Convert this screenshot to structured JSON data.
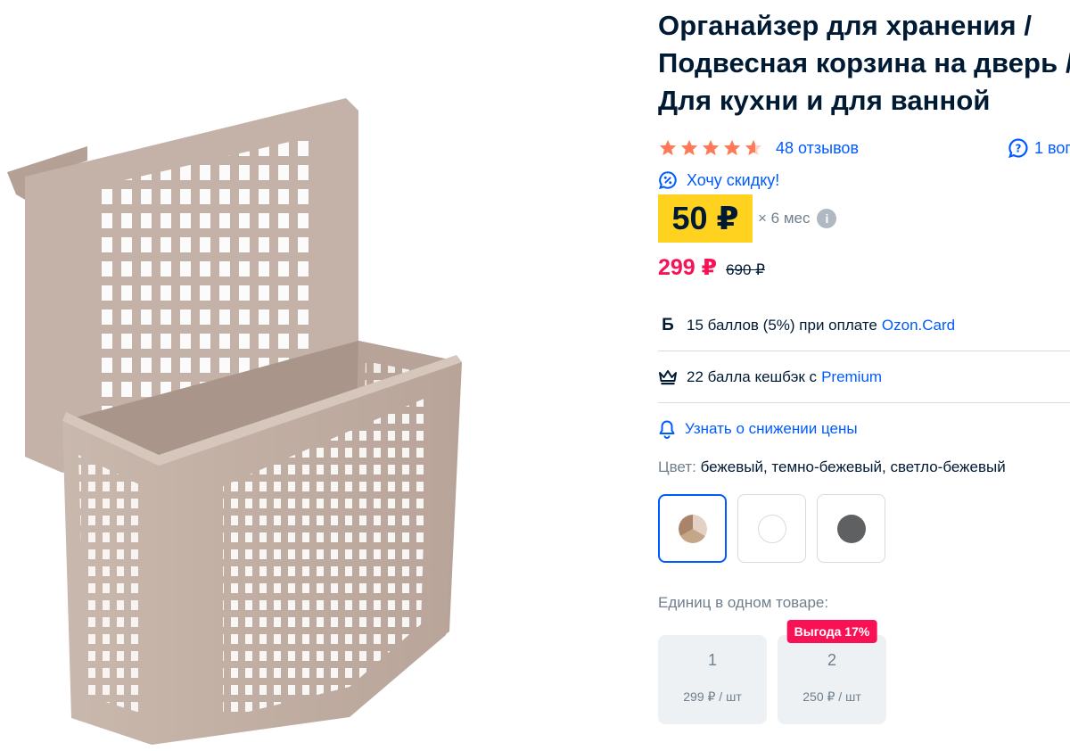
{
  "product": {
    "title_lines": [
      "Органайзер для хранения /",
      "Подвесная корзина на дверь /",
      "Для кухни и для ванной"
    ],
    "image_icon": "hanging-basket-photo"
  },
  "rating": {
    "stars": 4.5,
    "reviews_label": "48 отзывов",
    "questions_label": "1 воп"
  },
  "discount_link": "Хочу скидку!",
  "installment": {
    "amount": "50 ₽",
    "term": "× 6 мес",
    "info_glyph": "i"
  },
  "price": {
    "current": "299 ₽",
    "old": "690 ₽"
  },
  "bonuses": [
    {
      "icon_glyph": "Б",
      "icon": "points-icon",
      "text": "15 баллов (5%) при оплате",
      "link": "Ozon.Card"
    },
    {
      "icon": "crown-icon",
      "text": "22 балла кешбэк с",
      "link": "Premium"
    }
  ],
  "notify_link": "Узнать о снижении цены",
  "color": {
    "label": "Цвет:",
    "value": "бежевый, темно-бежевый, светло-бежевый",
    "swatches": [
      {
        "name": "multi-beige",
        "selected": true
      },
      {
        "name": "white",
        "color": "#ffffff",
        "selected": false
      },
      {
        "name": "dark-gray",
        "color": "#5f6062",
        "selected": false
      }
    ]
  },
  "units": {
    "label": "Единиц в одном товаре:",
    "options": [
      {
        "count": "1",
        "price": "299 ₽ / шт",
        "badge": ""
      },
      {
        "count": "2",
        "price": "250 ₽ / шт",
        "badge": "Выгода 17%"
      }
    ]
  },
  "colors": {
    "primary_blue": "#005bff",
    "sale_pink": "#f91155",
    "star_orange": "#ff7a59",
    "installment_yellow": "#ffd21f",
    "basket_beige": "#c8b5ab"
  }
}
